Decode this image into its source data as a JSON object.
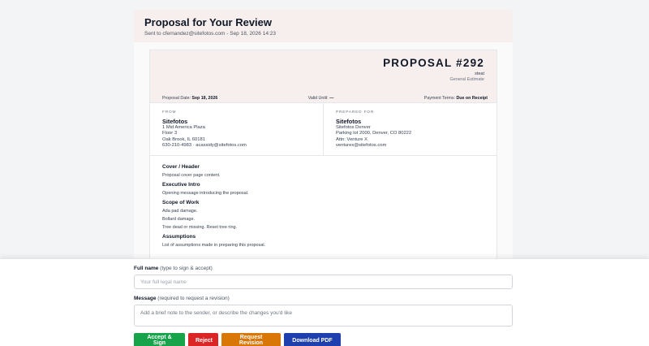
{
  "page": {
    "title": "Proposal for Your Review",
    "subtitle": "Sent to cfernandez@sitefotos.com - Sep 18, 2026 14:23"
  },
  "proposal": {
    "number": "PROPOSAL #292",
    "client_short": "steat",
    "type": "General Estimate",
    "meta": {
      "date_label": "Proposal Date:",
      "date_value": "Sep 18, 2026",
      "valid_label": "Valid Until:",
      "valid_value": "—",
      "terms_label": "Payment Terms:",
      "terms_value": "Due on Receipt"
    },
    "from": {
      "label": "FROM",
      "name": "Sitefotos",
      "line1": "1 Mid America Plaza",
      "line2": "Floor 3",
      "line3": "Oak Brook, IL 60181",
      "line4": "630-210-4983 · acassidy@sitefotos.com"
    },
    "to": {
      "label": "PREPARED FOR",
      "name": "Sitefotos",
      "line1": "Sitefotos Denver",
      "line2": "Parking lot 2000, Denver, CO 80222",
      "line3": "Attn: Venture X",
      "line4": "venturex@sitefotos.com"
    },
    "sections": [
      {
        "title": "Cover / Header",
        "lines": [
          "Proposal cover page content."
        ]
      },
      {
        "title": "Executive Intro",
        "lines": [
          "Opening message introducing the proposal."
        ]
      },
      {
        "title": "Scope of Work",
        "lines": [
          "Ada pad damage.",
          "Bollard damage.",
          "Tree dead or missing. Reset tree ring."
        ]
      },
      {
        "title": "Assumptions",
        "lines": [
          "List of assumptions made in preparing this proposal."
        ]
      }
    ]
  },
  "form": {
    "name_label": "Full name",
    "name_hint": "(type to sign & accept)",
    "name_placeholder": "Your full legal name",
    "message_label": "Message",
    "message_hint": "(required to request a revision)",
    "message_placeholder": "Add a brief note to the sender, or describe the changes you'd like"
  },
  "buttons": {
    "accept": "Accept & Sign",
    "reject": "Reject",
    "revision": "Request Revision",
    "download": "Download PDF"
  },
  "colors": {
    "accept": "#16a34a",
    "reject": "#dc2626",
    "revision": "#d97706",
    "download": "#1e40af",
    "header_bg": "#f7efed"
  }
}
